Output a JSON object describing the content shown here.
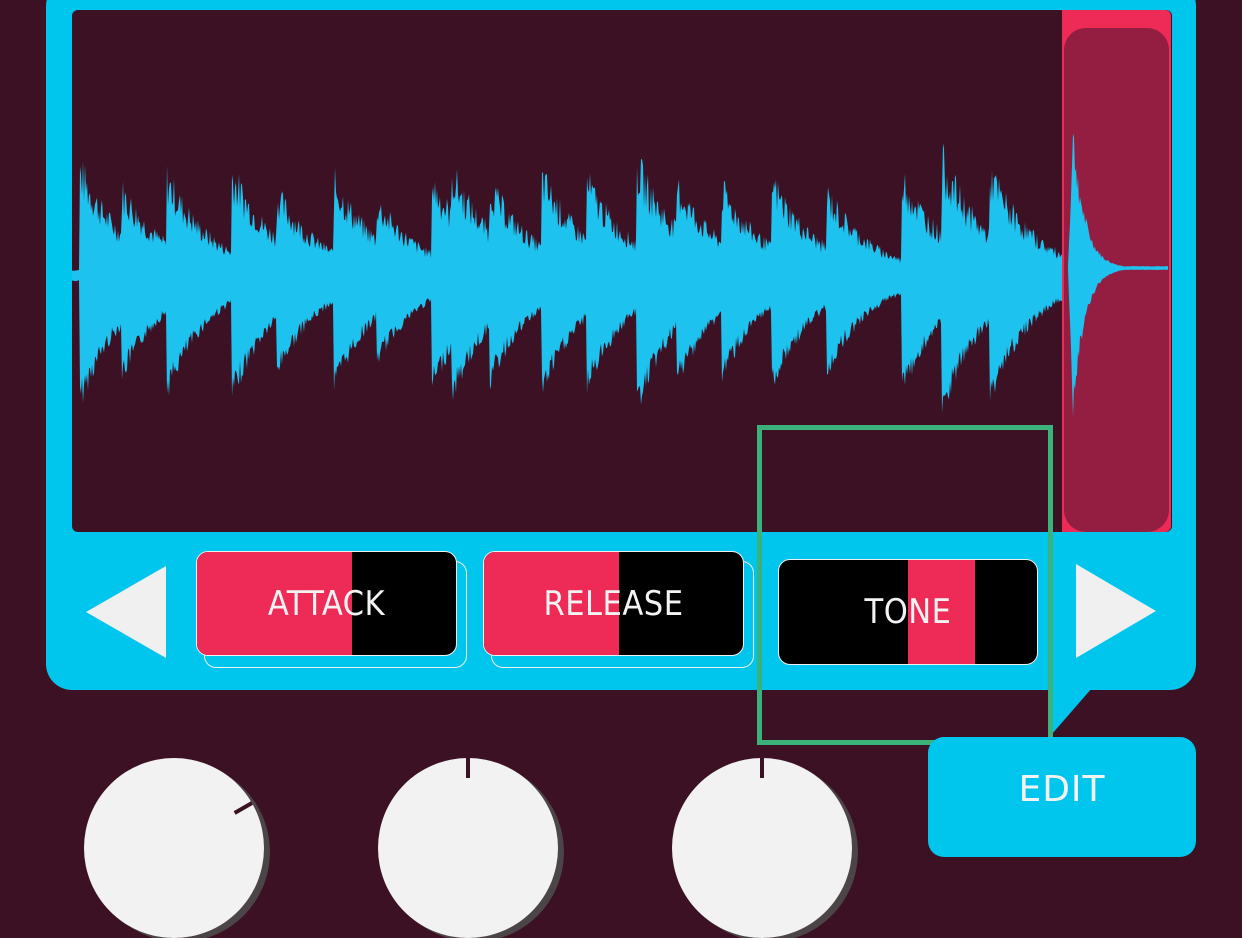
{
  "colors": {
    "background": "#3c1123",
    "panel": "#00c6ee",
    "waveform": "#1ec2ee",
    "accent": "#ee2a57",
    "highlight": "#3bb27c"
  },
  "parameters": [
    {
      "label": "ATTACK",
      "value_fraction": 0.6,
      "fill_from": "left"
    },
    {
      "label": "RELEASE",
      "value_fraction": 0.52,
      "fill_from": "left"
    },
    {
      "label": "TONE",
      "value_fraction": 0.26,
      "fill_from": "center"
    }
  ],
  "nav": {
    "prev_icon": "triangle-left-icon",
    "next_icon": "triangle-right-icon"
  },
  "edit_button": {
    "label": "EDIT"
  },
  "knobs": [
    {
      "name": "knob-1",
      "rotation_deg": 60
    },
    {
      "name": "knob-2",
      "rotation_deg": 0
    },
    {
      "name": "knob-3",
      "rotation_deg": 0
    }
  ]
}
